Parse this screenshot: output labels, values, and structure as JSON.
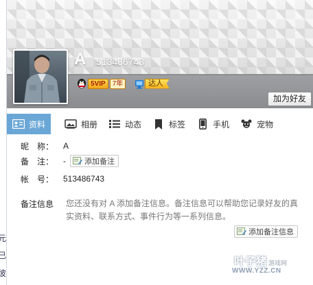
{
  "background_window": {
    "edge_glyphs": [
      "元",
      "已",
      "彼"
    ]
  },
  "profile": {
    "nickname": "A",
    "qq_number": "513486743",
    "vip_badge": "5VIP",
    "vip_year_number": "7",
    "vip_year_label": "年",
    "daren_badge": "达人",
    "add_friend_button": "加为好友"
  },
  "tabs": [
    {
      "label": "资料",
      "icon": "id-card-icon",
      "active": true
    },
    {
      "label": "相册",
      "icon": "photo-album-icon",
      "active": false
    },
    {
      "label": "动态",
      "icon": "feed-list-icon",
      "active": false
    },
    {
      "label": "标签",
      "icon": "bookmark-tag-icon",
      "active": false
    },
    {
      "label": "手机",
      "icon": "mobile-phone-icon",
      "active": false
    },
    {
      "label": "宠物",
      "icon": "pet-icon",
      "active": false
    }
  ],
  "details": {
    "nickname_label": "昵　称：",
    "nickname_value": "A",
    "remark_label": "备　注：",
    "remark_value": "-",
    "add_remark_button": "添加备注",
    "account_label": "帐　号：",
    "account_value": "513486743"
  },
  "remark_info": {
    "title": "备注信息",
    "description": "您还没有对 A 添加备注信息。备注信息可以帮助您记录好友的真实资料、联系方式、事件行为等一系列信息。",
    "add_button": "添加备注信息"
  },
  "watermark": {
    "brand": "叶子猪",
    "sub": "游戏网",
    "url": "WWW.YZZ.CN"
  },
  "colors": {
    "tab_active": "#6aa7d6",
    "header_band": "#8a8c8f",
    "vip_gold": "#f2a51a"
  }
}
